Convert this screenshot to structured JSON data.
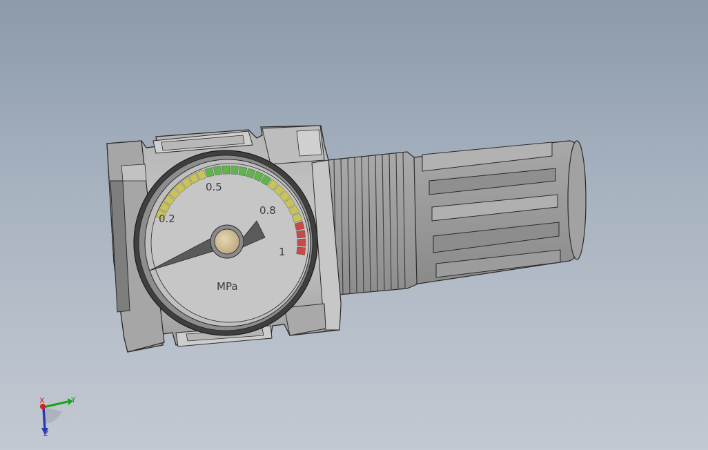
{
  "gauge": {
    "tick_labels": [
      "0.2",
      "0.5",
      "0.8",
      "1"
    ],
    "unit": "MPa",
    "needle_value": 0,
    "scale_max": 1,
    "zone_colors": {
      "low": "#c9c458",
      "normal": "#5fb44a",
      "high": "#c94848"
    }
  },
  "triad": {
    "x_label": "X",
    "y_label": "Y",
    "z_label": "Z",
    "colors": {
      "x": "#d02020",
      "y": "#1aa01a",
      "z": "#2a3ab0"
    }
  },
  "background": {
    "top": "#8c9aaa",
    "bottom": "#c3c9d2"
  }
}
